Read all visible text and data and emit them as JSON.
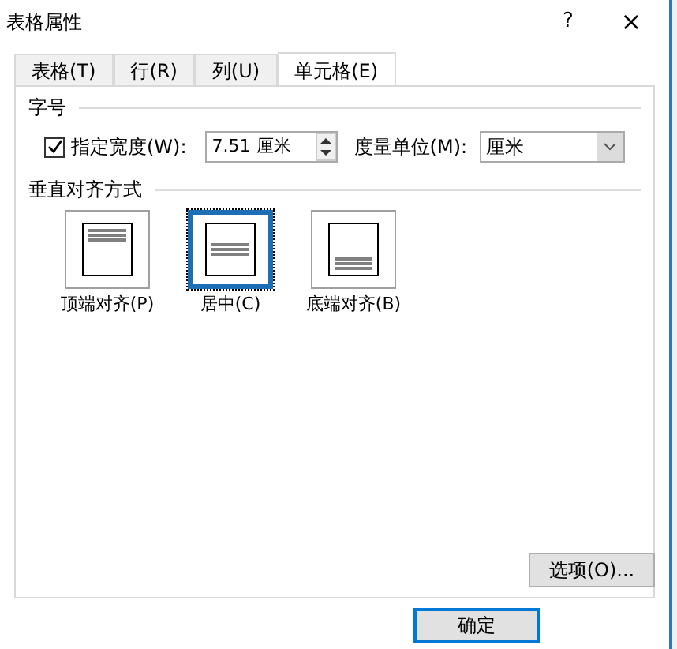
{
  "window": {
    "title": "表格属性",
    "help": "?",
    "close": "×"
  },
  "tabs": [
    {
      "label": "表格(T)",
      "selected": false
    },
    {
      "label": "行(R)",
      "selected": false
    },
    {
      "label": "列(U)",
      "selected": false
    },
    {
      "label": "单元格(E)",
      "selected": true
    }
  ],
  "size_section": {
    "title": "字号",
    "width_checkbox": {
      "label": "指定宽度(W):",
      "checked": true
    },
    "width_value": "7.51 厘米",
    "unit_label": "度量单位(M):",
    "unit_value": "厘米"
  },
  "vertical_alignment": {
    "title": "垂直对齐方式",
    "options": [
      {
        "label": "顶端对齐(P)",
        "kind": "top",
        "selected": false
      },
      {
        "label": "居中(C)",
        "kind": "center",
        "selected": true
      },
      {
        "label": "底端对齐(B)",
        "kind": "bottom",
        "selected": false
      }
    ]
  },
  "buttons": {
    "options": "选项(O)...",
    "ok": "确定"
  }
}
